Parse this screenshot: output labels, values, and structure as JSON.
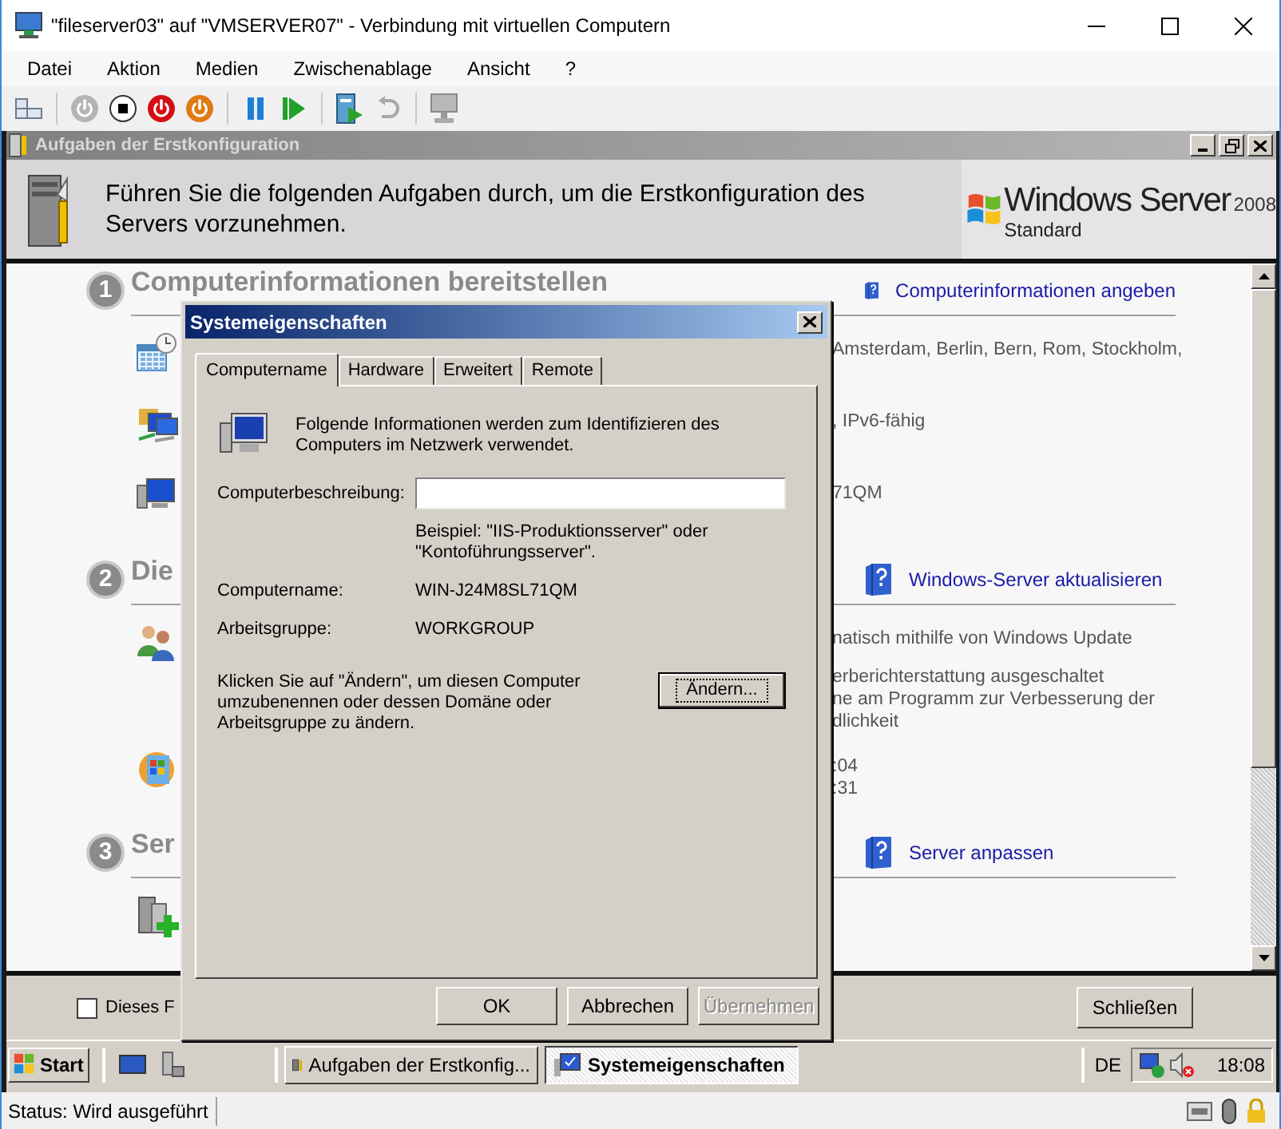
{
  "window": {
    "title": "\"fileserver03\" auf \"VMSERVER07\" - Verbindung mit virtuellen Computern"
  },
  "menu": [
    "Datei",
    "Aktion",
    "Medien",
    "Zwischenablage",
    "Ansicht",
    "?"
  ],
  "toolbar": [
    {
      "kind": "ctrl-alt-del",
      "disabled": false
    },
    {
      "kind": "start",
      "disabled": true
    },
    {
      "kind": "turn-off",
      "disabled": false
    },
    {
      "kind": "shut-down",
      "disabled": false
    },
    {
      "kind": "save",
      "disabled": false
    },
    {
      "kind": "pause",
      "disabled": false
    },
    {
      "kind": "reset",
      "disabled": false
    },
    {
      "kind": "checkpoint",
      "disabled": false
    },
    {
      "kind": "revert",
      "disabled": true
    },
    {
      "kind": "enhanced-session",
      "disabled": true
    }
  ],
  "guest": {
    "window_title": "Aufgaben der Erstkonfiguration",
    "banner": {
      "text": "Führen Sie die folgenden Aufgaben durch, um die Erstkonfiguration des Servers vorzunehmen.",
      "logo": {
        "name": "Windows Server",
        "version": "2008",
        "edition": "Standard"
      }
    },
    "sections": [
      {
        "number": "1",
        "title": "Computerinformationen bereitstellen",
        "link": "Computerinformationen angeben",
        "items": [
          {
            "kind": "time-zone",
            "paragraphs": [
              [
                "Amsterdam, Berlin, Bern, Rom, Stockholm,"
              ]
            ]
          },
          {
            "kind": "network",
            "paragraphs": [
              [
                ", IPv6-fähig"
              ]
            ]
          },
          {
            "kind": "computer",
            "paragraphs": [
              [
                "71QM"
              ]
            ]
          }
        ]
      },
      {
        "number": "2",
        "title": "Die",
        "link": "Windows-Server aktualisieren",
        "items": [
          {
            "kind": "users",
            "paragraphs": [
              [
                "natisch mithilfe von Windows Update"
              ],
              [
                "erberichterstattung ausgeschaltet",
                "ne am Programm zur Verbesserung der",
                "dlichkeit"
              ]
            ]
          },
          {
            "kind": "update",
            "paragraphs": [
              [
                ":04",
                ":31"
              ]
            ]
          }
        ]
      },
      {
        "number": "3",
        "title": "Ser",
        "link": "Server anpassen",
        "items": [
          {
            "kind": "add-roles"
          }
        ]
      }
    ],
    "checkbox": {
      "label": "Dieses F",
      "checked": false
    },
    "close_button": "Schließen",
    "taskbar": {
      "start": "Start",
      "tasks": [
        {
          "label": "Aufgaben der Erstkonfig...",
          "kind": "tasks",
          "selected": false
        },
        {
          "label": "Systemeigenschaften",
          "kind": "system",
          "selected": true
        }
      ],
      "language": "DE",
      "clock": "18:08"
    }
  },
  "dialog": {
    "title": "Systemeigenschaften",
    "tabs": [
      {
        "label": "Computername",
        "selected": true
      },
      {
        "label": "Hardware",
        "selected": false
      },
      {
        "label": "Erweitert",
        "selected": false
      },
      {
        "label": "Remote",
        "selected": false
      }
    ],
    "intro": "Folgende Informationen werden zum Identifizieren des Computers im Netzwerk verwendet.",
    "description_label": "Computerbeschreibung:",
    "example": "Beispiel: \"IIS-Produktionsserver\" oder \"Kontoführungsserver\".",
    "fields": [
      {
        "label": "Computername:",
        "value": "WIN-J24M8SL71QM"
      },
      {
        "label": "Arbeitsgruppe:",
        "value": "WORKGROUP"
      }
    ],
    "rename_text": "Klicken Sie auf \"Ändern\", um diesen Computer umzubenennen oder dessen Domäne oder Arbeitsgruppe zu ändern.",
    "rename_button": "Ändern...",
    "buttons": [
      {
        "label": "OK",
        "disabled": false
      },
      {
        "label": "Abbrechen",
        "disabled": false
      },
      {
        "label": "Übernehmen",
        "disabled": true
      }
    ]
  },
  "status_bar": {
    "text": "Status: Wird ausgeführt"
  }
}
